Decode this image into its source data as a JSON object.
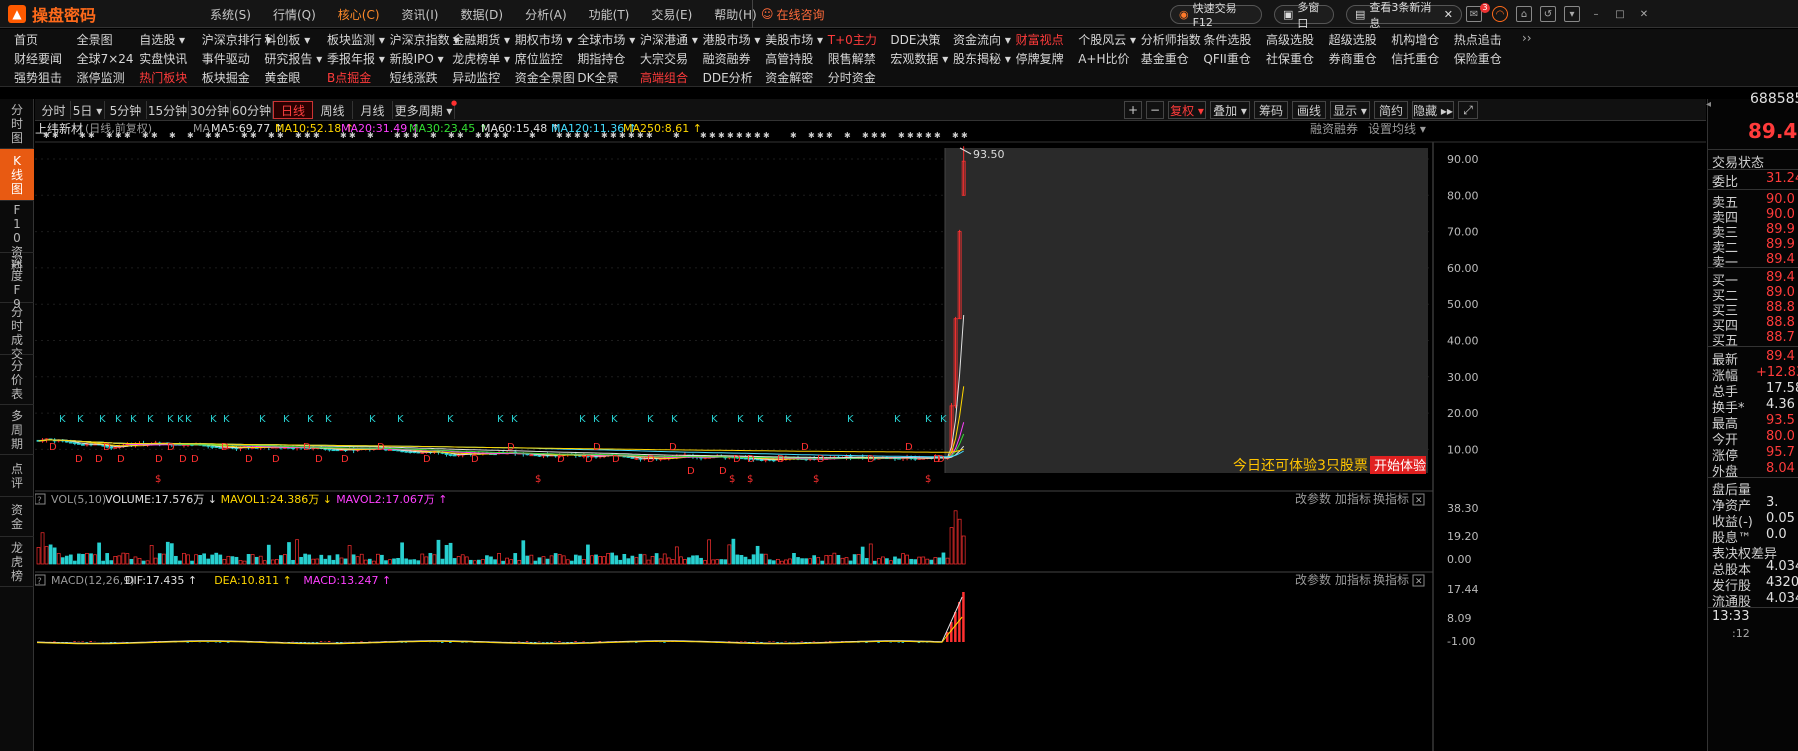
{
  "app": {
    "name": "操盘密码",
    "menu": [
      "系统(S)",
      "行情(Q)",
      "核心(C)",
      "资讯(I)",
      "数据(D)",
      "分析(A)",
      "功能(T)",
      "交易(E)",
      "帮助(H)"
    ],
    "active_menu": "核心(C)",
    "consult": "在线咨询",
    "quick_trade": "快速交易F12",
    "multi_window": "多窗口",
    "messages": "查看3条新消息",
    "msg_badge": "3"
  },
  "quick_nav": {
    "row1": [
      "首页",
      "全景图",
      "自选股 ▾",
      "沪深京排行 ▾",
      "科创板 ▾",
      "板块监测 ▾",
      "沪深京指数 ▾",
      "金融期货 ▾",
      "期权市场 ▾",
      "全球市场 ▾",
      "沪深港通 ▾",
      "港股市场 ▾",
      "美股市场 ▾",
      "T+0主力",
      "DDE决策",
      "资金流向 ▾",
      "财富视点",
      "个股风云 ▾",
      "分析师指数",
      "条件选股",
      "高级选股",
      "超级选股",
      "机构增仓",
      "热点追击"
    ],
    "row2": [
      "财经要闻",
      "全球7×24",
      "实盘快讯",
      "事件驱动",
      "研究报告 ▾",
      "季报年报 ▾",
      "新股IPO ▾",
      "龙虎榜单 ▾",
      "席位监控",
      "期指持仓",
      "大宗交易",
      "融资融券",
      "高管持股",
      "限售解禁",
      "宏观数据 ▾",
      "股东揭秘 ▾",
      "停牌复牌",
      "A+H比价",
      "基金重仓",
      "QFII重仓",
      "社保重仓",
      "券商重仓",
      "信托重仓",
      "保险重仓"
    ],
    "row3": [
      "强势狙击",
      "涨停监测",
      "热门板块",
      "板块掘金",
      "黄金眼",
      "B点掘金",
      "短线涨跌",
      "异动监控",
      "资金全景图",
      "DK全景",
      "高端组合",
      "DDE分析",
      "资金解密",
      "分时资金"
    ],
    "red_items": [
      "T+0主力",
      "财富视点",
      "热门板块",
      "B点掘金",
      "高端组合"
    ],
    "more": "››"
  },
  "left_nav": [
    "分时图",
    "K线图",
    "F10资料",
    "深度F9",
    "分时成交",
    "分价表",
    "多周期",
    "点评",
    "资金",
    "龙虎榜"
  ],
  "left_nav_active": "K线图",
  "period_tabs": [
    "分时",
    "5日 ▾",
    "5分钟",
    "15分钟",
    "30分钟",
    "60分钟",
    "日线",
    "周线",
    "月线",
    "更多周期 ▾"
  ],
  "period_active": "日线",
  "right_tools": [
    "+",
    "−",
    "复权 ▾",
    "叠加 ▾",
    "筹码",
    "画线",
    "显示 ▾",
    "简约",
    "隐藏 ▸▸",
    "⤢"
  ],
  "right_tools_active": "复权 ▾",
  "ma_line": {
    "name": "上纬新材",
    "mode": "(日线,前复权)",
    "ma_label": "MA",
    "items": [
      {
        "text": "MA5:69.77 ↑",
        "color": "#e0e0e0"
      },
      {
        "text": "MA10:52.18 ↑",
        "color": "#ffd700"
      },
      {
        "text": "MA20:31.49 ↑",
        "color": "#ff40ff"
      },
      {
        "text": "MA30:23.45 ↑",
        "color": "#33dd33"
      },
      {
        "text": "MA60:15.48 ↑",
        "color": "#e0e0e0"
      },
      {
        "text": "MA120:11.36 ↑",
        "color": "#44ddff"
      },
      {
        "text": "MA250:8.61 ↑",
        "color": "#ffd700"
      }
    ],
    "margin_trading": "融资融券",
    "set_ma": "设置均线 ▾"
  },
  "price_axis": [
    "90.00",
    "80.00",
    "70.00",
    "60.00",
    "50.00",
    "40.00",
    "30.00",
    "20.00",
    "10.00"
  ],
  "high_label": "93.50",
  "promo": {
    "text": "今日还可体验3只股票",
    "button": "开始体验"
  },
  "vol_panel": {
    "title": "VOL(5,10)",
    "items": [
      {
        "text": "VOLUME:17.576万 ↓",
        "color": "#e0e0e0"
      },
      {
        "text": "MAVOL1:24.386万 ↓",
        "color": "#ffd700"
      },
      {
        "text": "MAVOL2:17.067万 ↑",
        "color": "#ff40ff"
      }
    ],
    "axis": [
      "38.30",
      "19.20",
      "0.00"
    ],
    "buttons": [
      "改参数",
      "加指标",
      "换指标"
    ]
  },
  "macd_panel": {
    "title": "MACD(12,26,9)",
    "items": [
      {
        "text": "DIF:17.435 ↑",
        "color": "#e0e0e0"
      },
      {
        "text": "DEA:10.811 ↑",
        "color": "#ffd700"
      },
      {
        "text": "MACD:13.247 ↑",
        "color": "#ff40ff"
      }
    ],
    "axis": [
      "17.44",
      "8.09",
      "-1.00"
    ],
    "buttons": [
      "改参数",
      "加指标",
      "换指标"
    ]
  },
  "right_panel": {
    "code": "688585",
    "price": "89.4",
    "status_label": "交易状态",
    "wb_label": "委比",
    "wb_value": "31.24",
    "asks": [
      {
        "l": "卖五",
        "v": "90.0"
      },
      {
        "l": "卖四",
        "v": "90.0"
      },
      {
        "l": "卖三",
        "v": "89.9"
      },
      {
        "l": "卖二",
        "v": "89.9"
      },
      {
        "l": "卖一",
        "v": "89.4"
      }
    ],
    "bids": [
      {
        "l": "买一",
        "v": "89.4"
      },
      {
        "l": "买二",
        "v": "89.0"
      },
      {
        "l": "买三",
        "v": "88.8"
      },
      {
        "l": "买四",
        "v": "88.8"
      },
      {
        "l": "买五",
        "v": "88.7"
      }
    ],
    "stats": [
      {
        "l": "最新",
        "v": "89.4",
        "c": "r"
      },
      {
        "l": "涨幅",
        "v": "+12.83",
        "c": "r"
      },
      {
        "l": "总手",
        "v": "17.58",
        "c": "w"
      },
      {
        "l": "换手*",
        "v": "4.36",
        "c": "w"
      },
      {
        "l": "最高",
        "v": "93.5",
        "c": "r"
      },
      {
        "l": "今开",
        "v": "80.0",
        "c": "r"
      },
      {
        "l": "涨停",
        "v": "95.7",
        "c": "r"
      },
      {
        "l": "外盘",
        "v": "8.04",
        "c": "r"
      }
    ],
    "fin": [
      {
        "l": "盘后量",
        "v": ""
      },
      {
        "l": "净资产",
        "v": "3."
      },
      {
        "l": "收益(-)",
        "v": "0.05"
      },
      {
        "l": "股息™",
        "v": "0.0"
      },
      {
        "l": "表决权差异",
        "v": ""
      },
      {
        "l": "总股本",
        "v": "4.034"
      },
      {
        "l": "发行股",
        "v": "4320"
      },
      {
        "l": "流通股",
        "v": "4.034"
      }
    ],
    "time": "13:33",
    "time2": ":12"
  },
  "chart_data": {
    "type": "candlestick",
    "series_note": "",
    "x": [],
    "ylim": [
      0,
      95
    ],
    "last_close": 89.4,
    "high": 93.5
  }
}
